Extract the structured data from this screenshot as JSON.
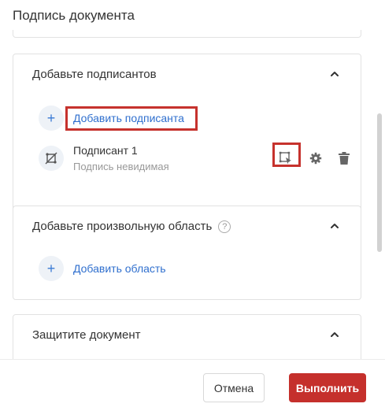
{
  "dialog": {
    "title": "Подпись документа"
  },
  "signers_section": {
    "title": "Добавьте подписантов",
    "add_plus": "+",
    "add_label": "Добавить подписанта",
    "signer": {
      "name": "Подписант 1",
      "status": "Подпись невидимая"
    }
  },
  "area_section": {
    "title": "Добавьте произвольную область",
    "help": "?",
    "add_plus": "+",
    "add_label": "Добавить область"
  },
  "protect_section": {
    "title": "Защитите документ"
  },
  "footer": {
    "cancel_label": "Отмена",
    "submit_label": "Выполнить"
  },
  "colors": {
    "accent": "#2f6fce",
    "primary_button": "#c5302c",
    "highlight": "#c6322d"
  }
}
